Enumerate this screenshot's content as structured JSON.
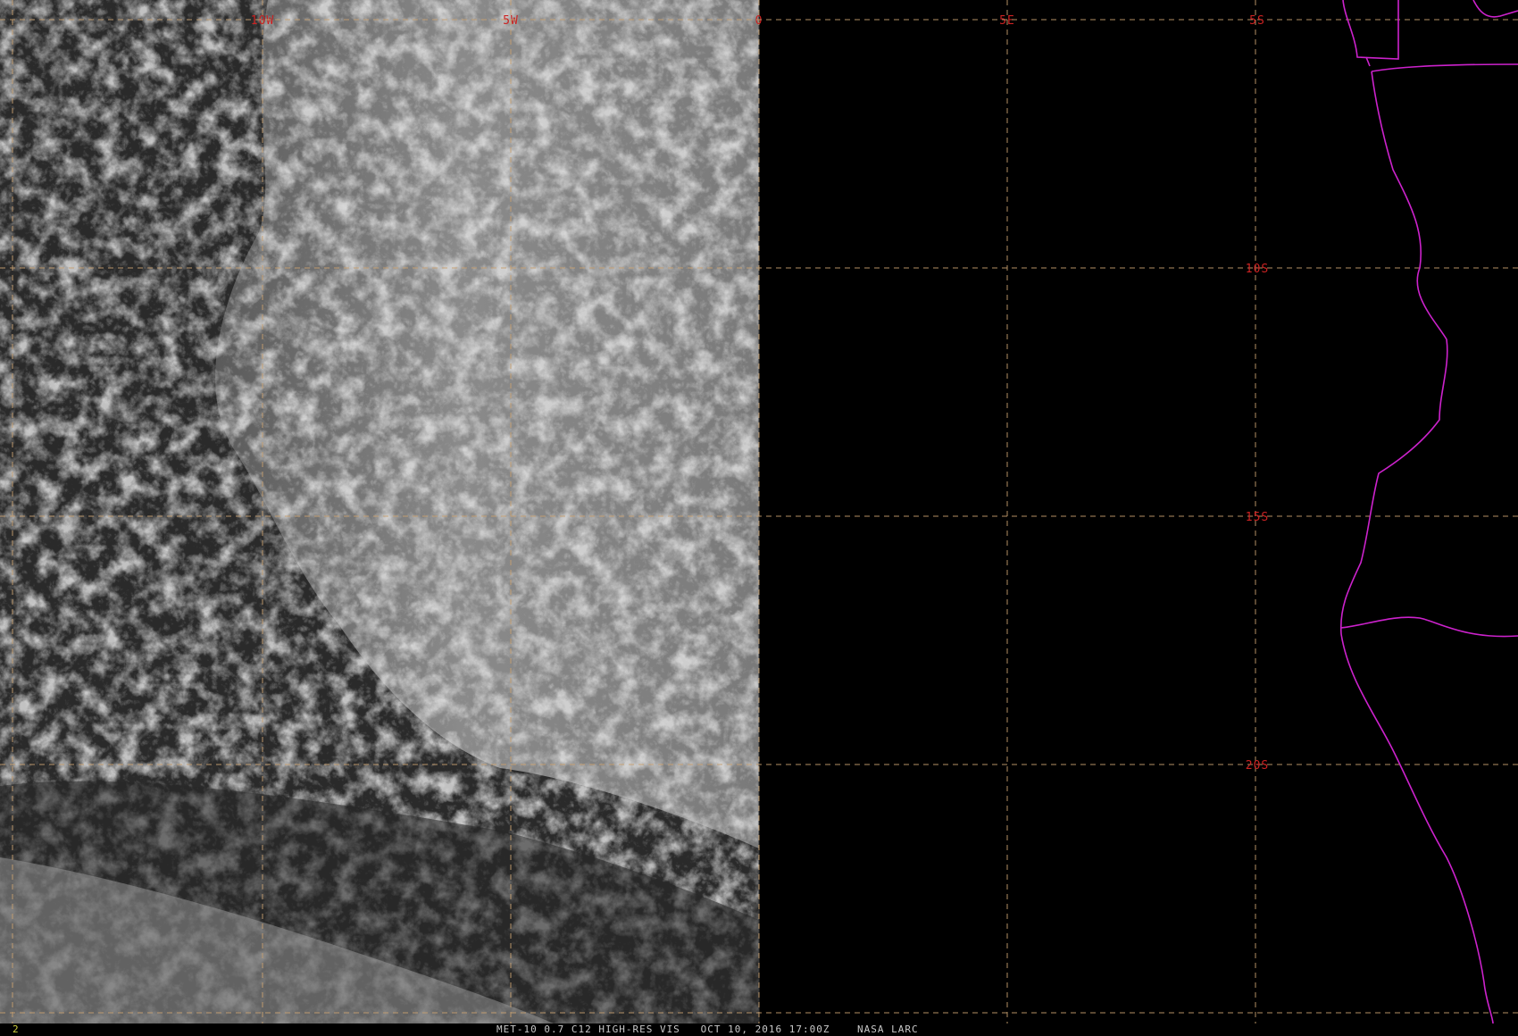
{
  "image": {
    "caption": "MET-10 0.7 C12 HIGH-RES VIS   OCT 10, 2016 17:00Z    NASA LARC",
    "frame_number": "2"
  },
  "colors": {
    "background": "#000000",
    "graticule": "#c8a070",
    "grid_label": "#cc2222",
    "boundary": "#cc22cc",
    "caption_text": "#c8c8c8",
    "frame_number": "#d0d040",
    "cloud_light": "#b4b4b4",
    "cloud_dark": "#2a2a2a"
  },
  "graticule": {
    "longitude_labels": [
      "10W",
      "5W",
      "0",
      "5E"
    ],
    "latitude_labels": [
      "5S",
      "10S",
      "15S",
      "20S"
    ]
  },
  "layers": {
    "clouds": "visible-channel-cloud-imagery",
    "coastline": "africa-coastline",
    "borders": "country-boundaries"
  }
}
